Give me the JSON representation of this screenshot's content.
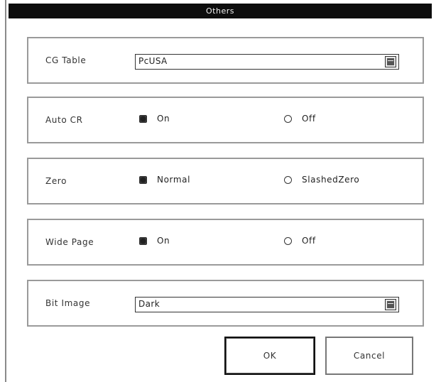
{
  "dialog": {
    "title": "Others"
  },
  "cg_table": {
    "label": "CG Table",
    "value": "PcUSA"
  },
  "auto_cr": {
    "label": "Auto CR",
    "options": [
      "On",
      "Off"
    ],
    "selected": "On"
  },
  "zero": {
    "label": "Zero",
    "options": [
      "Normal",
      "SlashedZero"
    ],
    "selected": "Normal"
  },
  "wide_page": {
    "label": "Wide Page",
    "options": [
      "On",
      "Off"
    ],
    "selected": "On"
  },
  "bit_image": {
    "label": "Bit Image",
    "value": "Dark"
  },
  "buttons": {
    "ok": "OK",
    "cancel": "Cancel"
  }
}
